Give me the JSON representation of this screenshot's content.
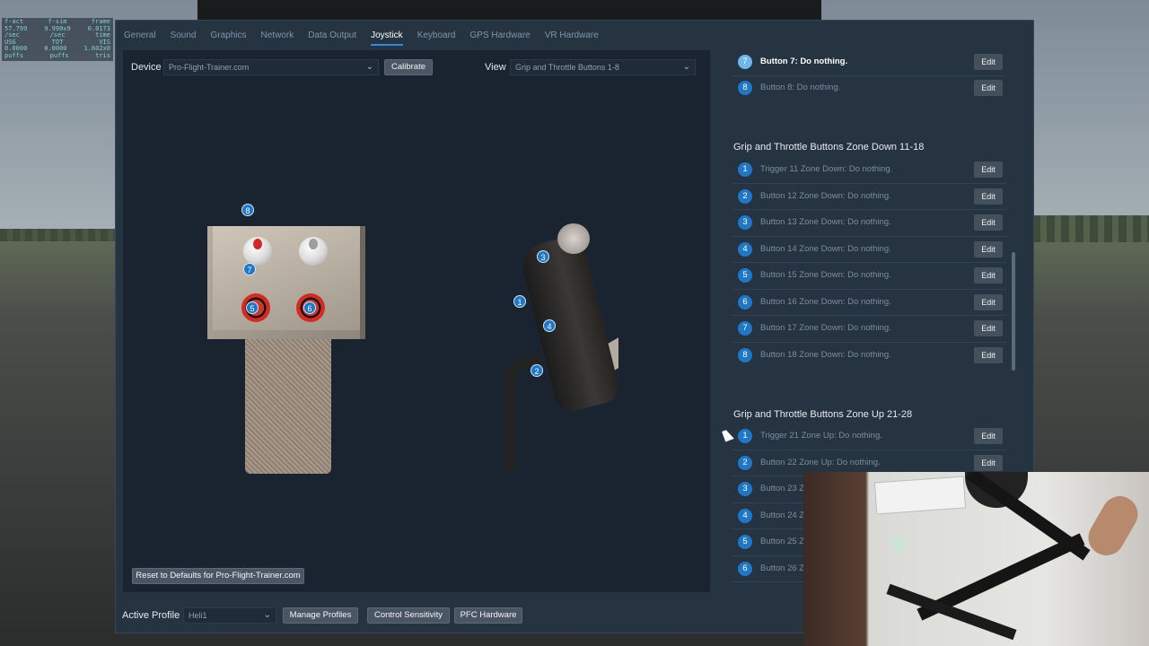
{
  "stats": {
    "row1": [
      "f-act",
      "f-sim",
      "frame"
    ],
    "row2": [
      "57.799",
      "9.990x9",
      "0.0173"
    ],
    "row3": [
      "/sec",
      "/sec",
      "time"
    ],
    "row4": [
      "USG",
      "TOT",
      "VIS"
    ],
    "row5": [
      "0.0000",
      "0.0000",
      "1.602x0"
    ],
    "row6": [
      "puffs",
      "puffs",
      "tris"
    ]
  },
  "tabs": [
    "General",
    "Sound",
    "Graphics",
    "Network",
    "Data Output",
    "Joystick",
    "Keyboard",
    "GPS Hardware",
    "VR Hardware"
  ],
  "active_tab": "Joystick",
  "device": {
    "label": "Device",
    "value": "Pro-Flight-Trainer.com",
    "calibrate_label": "Calibrate"
  },
  "view": {
    "label": "View",
    "value": "Grip and Throttle Buttons 1-8"
  },
  "markers": [
    "8",
    "7",
    "5",
    "6",
    "3",
    "1",
    "4",
    "2"
  ],
  "reset_label": "Reset to Defaults for Pro-Flight-Trainer.com",
  "edit_label": "Edit",
  "top_items": [
    {
      "num": "7",
      "label": "Button 7: Do nothing."
    },
    {
      "num": "8",
      "label": "Button 8: Do nothing."
    }
  ],
  "section_down": {
    "title": "Grip and Throttle Buttons Zone Down 11-18",
    "items": [
      {
        "num": "1",
        "label": "Trigger 11 Zone Down: Do nothing."
      },
      {
        "num": "2",
        "label": "Button 12 Zone Down: Do nothing."
      },
      {
        "num": "3",
        "label": "Button 13 Zone Down: Do nothing."
      },
      {
        "num": "4",
        "label": "Button 14 Zone Down: Do nothing."
      },
      {
        "num": "5",
        "label": "Button 15 Zone Down: Do nothing."
      },
      {
        "num": "6",
        "label": "Button 16 Zone Down: Do nothing."
      },
      {
        "num": "7",
        "label": "Button 17 Zone Down: Do nothing."
      },
      {
        "num": "8",
        "label": "Button 18 Zone Down: Do nothing."
      }
    ]
  },
  "section_up": {
    "title": "Grip and Throttle Buttons Zone Up 21-28",
    "items": [
      {
        "num": "1",
        "label": "Trigger 21 Zone Up: Do nothing."
      },
      {
        "num": "2",
        "label": "Button 22 Zone Up: Do nothing."
      },
      {
        "num": "3",
        "label": "Button 23 Z"
      },
      {
        "num": "4",
        "label": "Button 24 Z"
      },
      {
        "num": "5",
        "label": "Button 25 Z"
      },
      {
        "num": "6",
        "label": "Button 26 Z"
      }
    ]
  },
  "bottom": {
    "active_profile_label": "Active Profile",
    "profile_value": "Heli1",
    "manage_profiles": "Manage Profiles",
    "control_sensitivity": "Control Sensitivity",
    "pfc_hardware": "PFC Hardware"
  },
  "colors": {
    "window_bg": "#263442",
    "panel_bg": "#1a2430",
    "accent": "#2c8ae6",
    "marker": "#1f77c7"
  }
}
